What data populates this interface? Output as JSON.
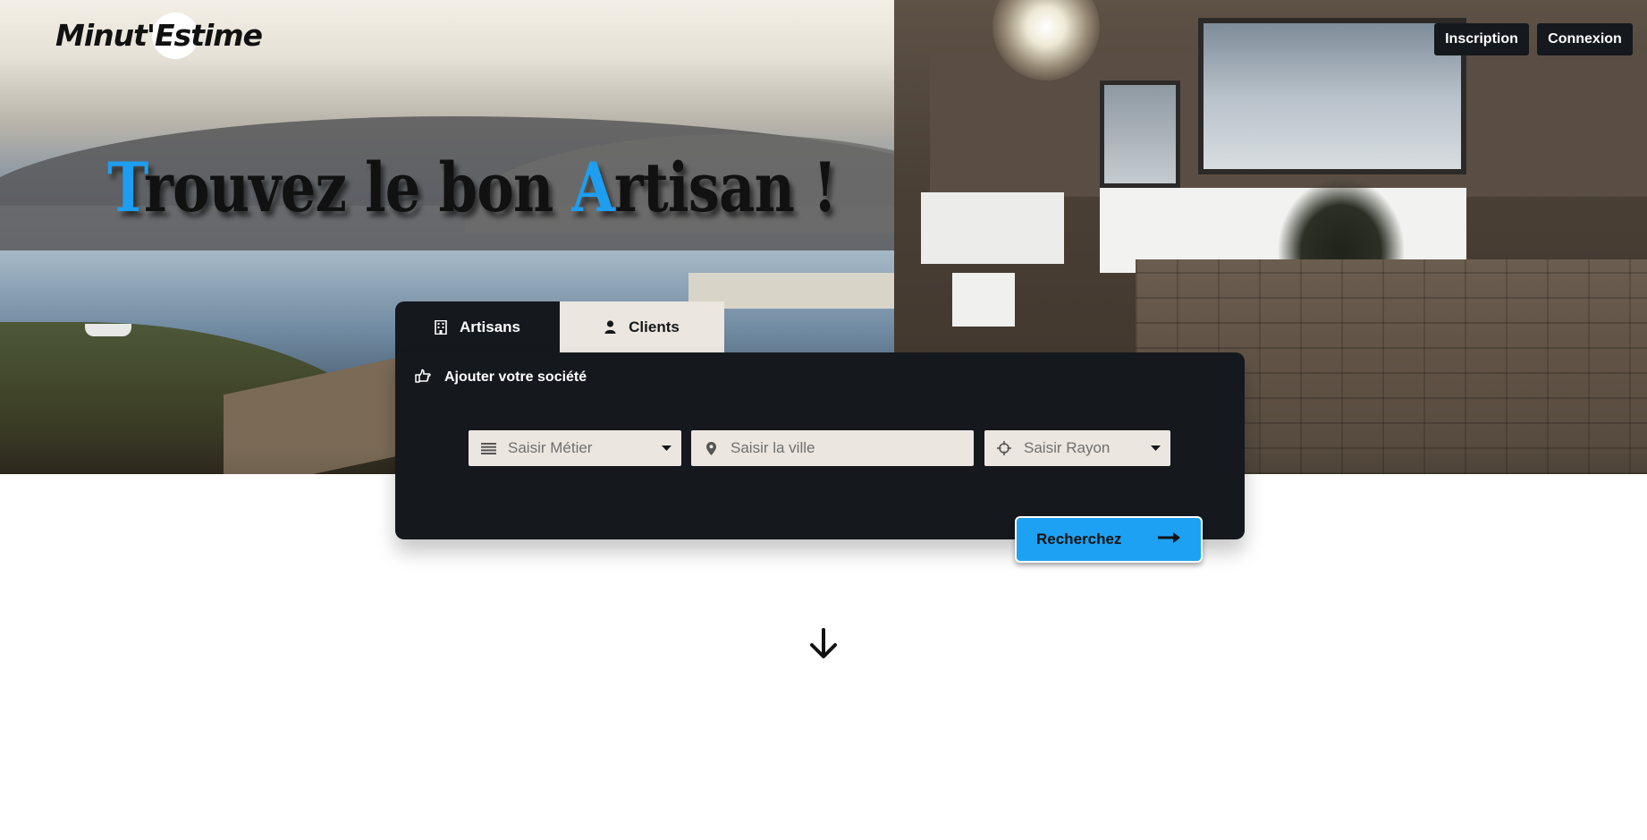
{
  "header": {
    "logo_text": "Minut'Estime",
    "nav": {
      "inscription_label": "Inscription",
      "connexion_label": "Connexion"
    }
  },
  "hero": {
    "headline_first_letter": "T",
    "headline_part1": "rouvez le bon ",
    "headline_accent_letter": "A",
    "headline_part2": "rtisan !",
    "accent_color": "#1e9ef0"
  },
  "search": {
    "tabs": [
      {
        "label": "Artisans",
        "icon": "building-icon",
        "active": true
      },
      {
        "label": "Clients",
        "icon": "user-icon",
        "active": false
      }
    ],
    "add_company_label": "Ajouter votre société",
    "add_company_icon": "hand-point-right-icon",
    "fields": {
      "metier_placeholder": "Saisir Métier",
      "ville_placeholder": "Saisir la ville",
      "rayon_placeholder": "Saisir Rayon"
    },
    "submit_label": "Recherchez",
    "submit_color": "#1da1f2"
  },
  "scroll_icon": "arrow-down-icon"
}
